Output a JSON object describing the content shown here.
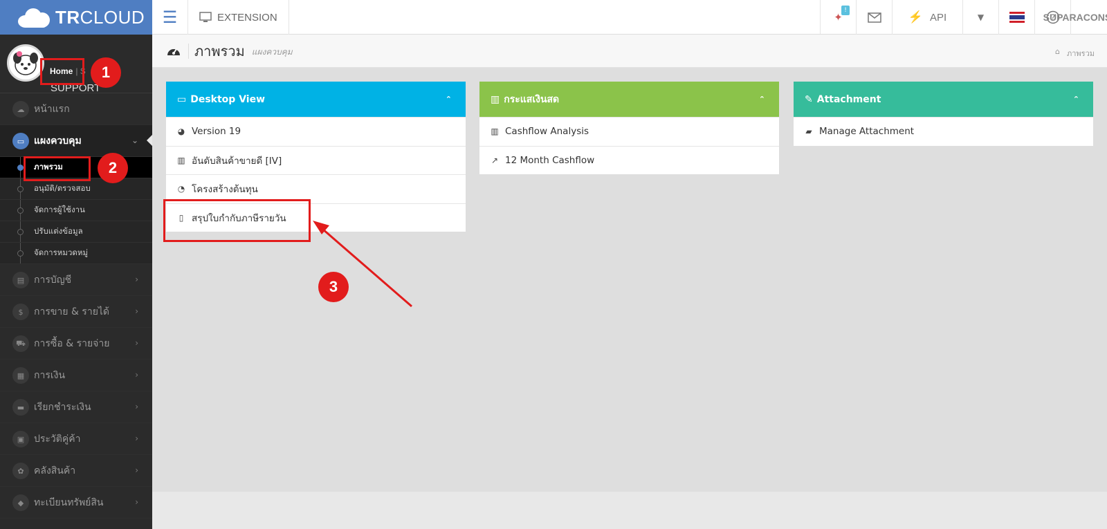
{
  "brand": {
    "logo_bold": "TR",
    "logo_light": "CLOUD"
  },
  "profile": {
    "name": "SUPPORT",
    "home_link": "Home",
    "sep": "| S"
  },
  "sidebar": {
    "items": [
      {
        "label": "หน้าแรก",
        "icon": "cloud-icon"
      },
      {
        "label": "แผงควบคุม",
        "icon": "monitor-icon"
      },
      {
        "label": "การบัญชี",
        "icon": "book-icon"
      },
      {
        "label": "การขาย & รายได้",
        "icon": "dollar-icon"
      },
      {
        "label": "การซื้อ & รายจ่าย",
        "icon": "cart-icon"
      },
      {
        "label": "การเงิน",
        "icon": "calendar-icon"
      },
      {
        "label": "เรียกชำระเงิน",
        "icon": "card-icon"
      },
      {
        "label": "ประวัติคู่ค้า",
        "icon": "contact-icon"
      },
      {
        "label": "คลังสินค้า",
        "icon": "boxes-icon"
      },
      {
        "label": "ทะเบียนทรัพย์สิน",
        "icon": "gem-icon"
      }
    ],
    "subitems": [
      "ภาพรวม",
      "อนุมัติ/ตรวจสอบ",
      "จัดการผู้ใช้งาน",
      "ปรับแต่งข้อมูล",
      "จัดการหมวดหมู่"
    ]
  },
  "topbar": {
    "extension": "EXTENSION",
    "api": "API",
    "user": "SUPARACONSULT",
    "badge": "!"
  },
  "page": {
    "title": "ภาพรวม",
    "subtitle": "แผงควบคุม",
    "crumb": "ภาพรวม"
  },
  "panels": {
    "desktop": {
      "title": "Desktop View",
      "color": "#00b2e5",
      "rows": [
        "Version 19",
        "อันดับสินค้าขายดี [IV]",
        "โครงสร้างต้นทุน",
        "สรุปใบกำกับภาษีรายวัน"
      ]
    },
    "cash": {
      "title": "กระแสเงินสด",
      "color": "#8bc34a",
      "rows": [
        "Cashflow Analysis",
        "12 Month Cashflow"
      ]
    },
    "attach": {
      "title": "Attachment",
      "color": "#36bc9b",
      "rows": [
        "Manage Attachment"
      ]
    }
  },
  "annotations": {
    "n1": "1",
    "n2": "2",
    "n3": "3",
    "color": "#e21c1c"
  }
}
